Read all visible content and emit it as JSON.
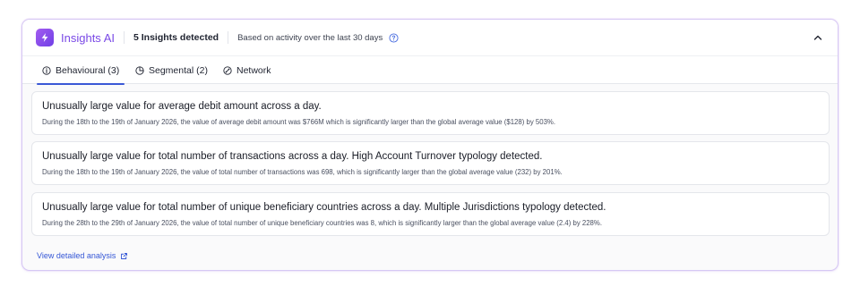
{
  "header": {
    "brand": "Insights AI",
    "count_label": "5 Insights detected",
    "note": "Based on activity over the last 30 days"
  },
  "tabs": [
    {
      "label": "Behavioural (3)",
      "icon": "info-circle-icon",
      "active": true
    },
    {
      "label": "Segmental (2)",
      "icon": "pie-chart-icon",
      "active": false
    },
    {
      "label": "Network",
      "icon": "network-icon",
      "active": false
    }
  ],
  "insights": [
    {
      "title": "Unusually large value for average debit amount across a day.",
      "description": "During the 18th to the 19th of January 2026, the value of average debit amount was $766M which is significantly larger than the global average value ($128) by 503%."
    },
    {
      "title": "Unusually large value for total number of transactions across a day. High Account Turnover typology detected.",
      "description": "During the 18th to the 19th of January 2026, the value of total number of transactions was 698, which is significantly larger than the global average value (232) by 201%."
    },
    {
      "title": "Unusually large value for total number of unique beneficiary countries across a day. Multiple Jurisdictions typology detected.",
      "description": "During the 28th to the 29th of January 2026, the value of total number of unique beneficiary countries was 8, which is significantly larger than the global average value (2.4) by 228%."
    }
  ],
  "footer": {
    "link_label": "View detailed analysis"
  },
  "colors": {
    "brand": "#7a49e6",
    "accent": "#3a58d6",
    "border": "#d6c8f4"
  }
}
